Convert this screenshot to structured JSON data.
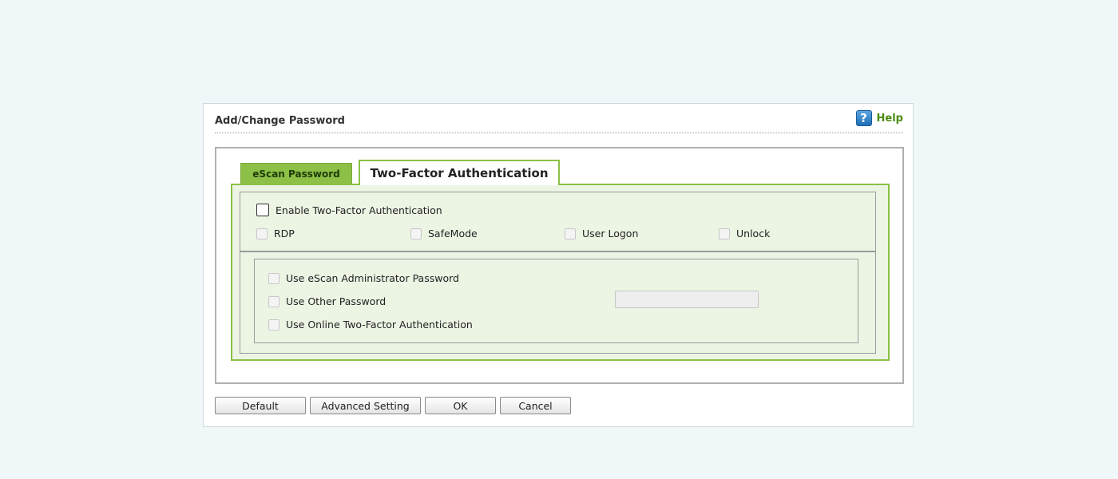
{
  "dialog": {
    "title": "Add/Change Password",
    "help_label": "Help",
    "help_icon": "question-mark-icon"
  },
  "tabs": [
    {
      "label": "eScan Password",
      "active": false
    },
    {
      "label": "Two-Factor Authentication",
      "active": true
    }
  ],
  "two_factor": {
    "enable_label": "Enable Two-Factor Authentication",
    "enable_checked": false,
    "logon_options": [
      {
        "label": "RDP",
        "checked": false,
        "disabled": true
      },
      {
        "label": "SafeMode",
        "checked": false,
        "disabled": true
      },
      {
        "label": "User Logon",
        "checked": false,
        "disabled": true
      },
      {
        "label": "Unlock",
        "checked": false,
        "disabled": true
      }
    ],
    "password_options": [
      {
        "label": "Use eScan Administrator Password",
        "checked": false,
        "disabled": true
      },
      {
        "label": "Use Other Password",
        "checked": false,
        "disabled": true
      },
      {
        "label": "Use Online Two-Factor Authentication",
        "checked": false,
        "disabled": true
      }
    ],
    "other_password_value": ""
  },
  "buttons": {
    "default": "Default",
    "advanced": "Advanced Setting",
    "ok": "OK",
    "cancel": "Cancel"
  },
  "colors": {
    "accent_green": "#8cc046",
    "panel_bg": "#ecf4e4",
    "help_green": "#4a8c10"
  }
}
